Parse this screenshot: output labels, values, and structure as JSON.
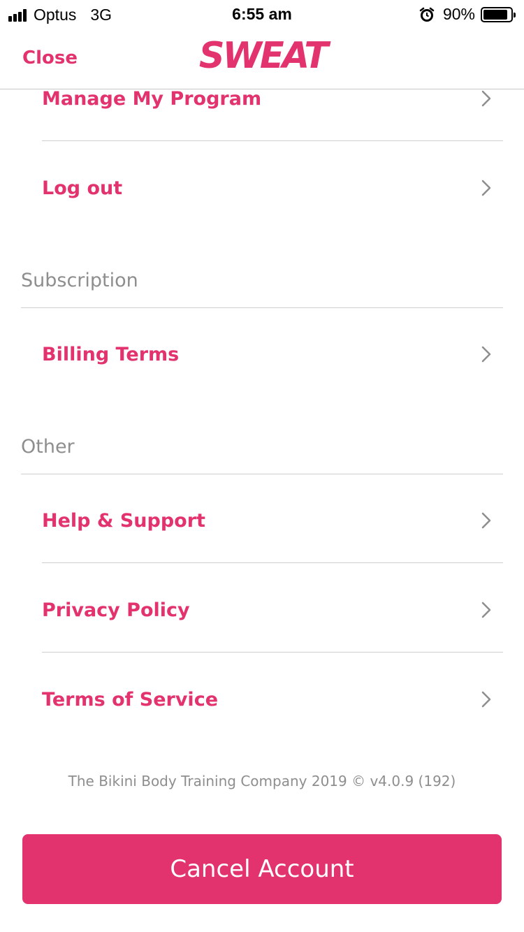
{
  "status_bar": {
    "carrier": "Optus",
    "network": "3G",
    "time": "6:55 am",
    "battery_percent": "90%",
    "battery_level": 0.9,
    "icons": [
      "signal-icon",
      "alarm-icon",
      "battery-icon"
    ]
  },
  "nav": {
    "close_label": "Close",
    "logo_text": "SWEAT"
  },
  "account_items": [
    {
      "label": "Manage My Program"
    },
    {
      "label": "Log out"
    }
  ],
  "subscription": {
    "header": "Subscription",
    "items": [
      {
        "label": "Billing Terms"
      }
    ]
  },
  "other": {
    "header": "Other",
    "items": [
      {
        "label": "Help & Support"
      },
      {
        "label": "Privacy Policy"
      },
      {
        "label": "Terms of Service"
      }
    ]
  },
  "footer": {
    "text": "The Bikini Body Training Company 2019 © v4.0.9 (192)"
  },
  "cancel_button": {
    "label": "Cancel Account"
  },
  "colors": {
    "accent": "#e3336e",
    "secondary_text": "#8e8e8e",
    "divider": "#cfcfcf"
  }
}
